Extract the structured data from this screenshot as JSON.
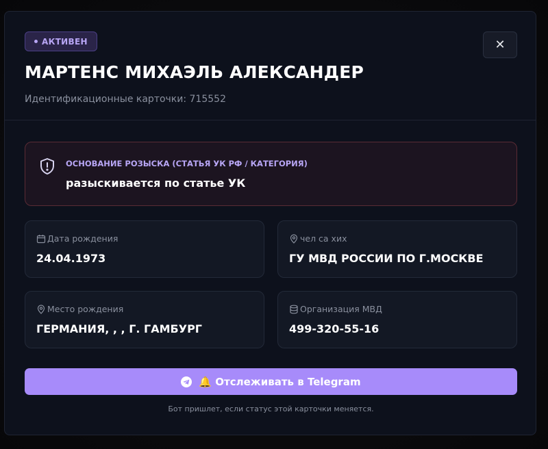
{
  "status": {
    "label": "АКТИВЕН",
    "color": "#b8a6f5"
  },
  "close": {
    "icon": "close-icon",
    "glyph": "✕"
  },
  "person": {
    "name": "МАРТЕНС МИХАЭЛЬ АЛЕКСАНДЕР",
    "id_line": "Идентификационные карточки: 715552"
  },
  "alert": {
    "icon": "shield-alert-icon",
    "label": "ОСНОВАНИЕ РОЗЫСКА (СТАТЬЯ УК РФ / КАТЕГОРИЯ)",
    "value": "разыскивается по статье УК"
  },
  "fields": [
    {
      "icon": "calendar-icon",
      "label": "Дата рождения",
      "value": "24.04.1973"
    },
    {
      "icon": "location-pin-icon",
      "label": "чел са хих",
      "value": "ГУ МВД РОССИИ ПО Г.МОСКВЕ"
    },
    {
      "icon": "location-pin-icon",
      "label": "Место рождения",
      "value": "ГЕРМАНИЯ, , , Г. ГАМБУРГ"
    },
    {
      "icon": "database-icon",
      "label": "Организация МВД",
      "value": "499-320-55-16"
    }
  ],
  "track": {
    "label": "🔔 Отслеживать в Telegram",
    "icon": "telegram-icon"
  },
  "hint": "Бот пришлет, если статус этой карточки меняется.",
  "colors": {
    "accent": "#a78bfa",
    "alert_border": "#5a2b35",
    "background": "#0d111c"
  }
}
